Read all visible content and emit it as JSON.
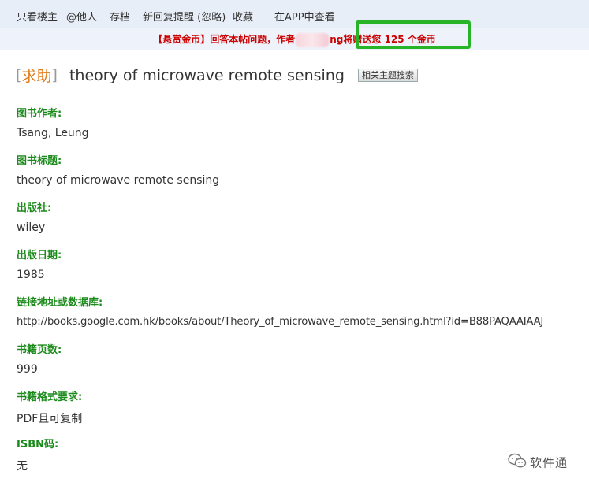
{
  "toolbar": {
    "items": [
      "只看楼主",
      "@他人",
      "存档",
      "新回复提醒 (忽略)",
      "收藏",
      "在APP中查看"
    ]
  },
  "notice": {
    "prefix": "【悬赏金币】回答本帖问题，作者",
    "suffix": "ng将赠送您 125 个金币"
  },
  "post": {
    "tag": "求助",
    "title": "theory of microwave remote sensing",
    "related_button": "相关主题搜索"
  },
  "fields": [
    {
      "label": "图书作者:",
      "value": "Tsang, Leung"
    },
    {
      "label": "图书标题:",
      "value": "theory of microwave remote sensing"
    },
    {
      "label": "出版社:",
      "value": "wiley"
    },
    {
      "label": "出版日期:",
      "value": "1985"
    },
    {
      "label": "链接地址或数据库:",
      "value": "http://books.google.com.hk/books/about/Theory_of_microwave_remote_sensing.html?id=B88PAQAAIAAJ"
    },
    {
      "label": "书籍页数:",
      "value": "999"
    },
    {
      "label": "书籍格式要求:",
      "value": "PDF且可复制"
    },
    {
      "label": "ISBN码:",
      "value": "无"
    }
  ],
  "watermark": {
    "icon": "wechat-icon",
    "text": "软件通"
  },
  "colors": {
    "field_label": "#1a8a1a",
    "notice_text": "#cc0000",
    "highlight_box": "#27b427",
    "tag": "#e07b1a"
  }
}
